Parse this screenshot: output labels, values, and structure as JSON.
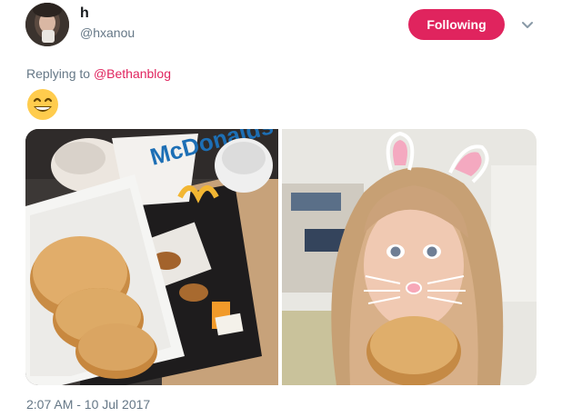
{
  "tweet": {
    "author": {
      "display_name": "h",
      "handle": "@hxanou"
    },
    "follow_button_label": "Following",
    "reply_prefix": "Replying to",
    "reply_to": "@Bethanblog",
    "emoji": "grinning-face-with-smiling-eyes",
    "media": [
      {
        "name": "mcdonalds-breakfast-tray-photo",
        "logo_text": "McDonalds"
      },
      {
        "name": "selfie-with-bunny-filter-photo"
      }
    ],
    "timestamp": "2:07 AM - 10 Jul 2017"
  },
  "colors": {
    "accent": "#e0245e",
    "secondary_text": "#657786",
    "primary_text": "#14171a"
  }
}
